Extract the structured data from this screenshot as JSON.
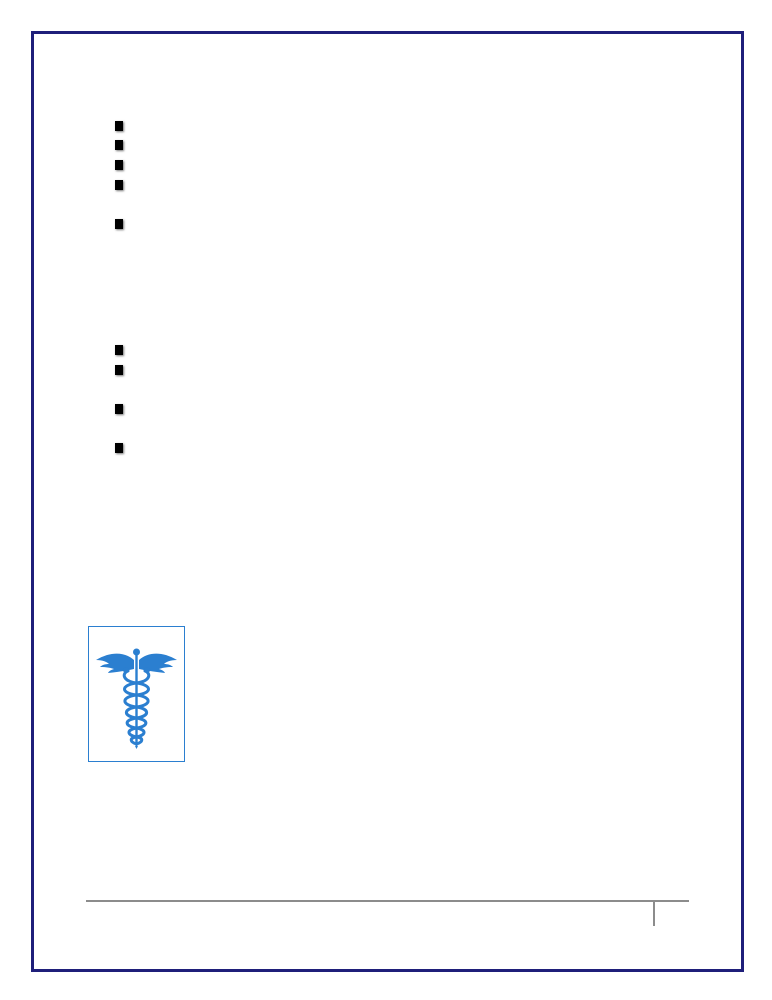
{
  "document": {
    "border_color": "#1f1f7a",
    "bullet_groups": [
      {
        "name": "first-list",
        "bullet_count": 5
      },
      {
        "name": "second-list",
        "bullet_count": 4
      }
    ],
    "logo": {
      "icon": "caduceus-icon",
      "color": "#2b7fd0"
    },
    "footer": {
      "rule_color": "#8c8c8c",
      "page_number": ""
    }
  }
}
